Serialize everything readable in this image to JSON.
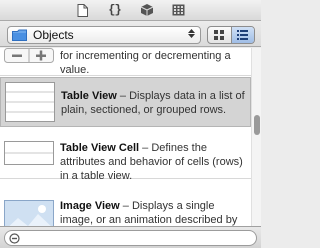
{
  "toolbar": {
    "tabs": [
      {
        "icon": "file-template-icon"
      },
      {
        "icon": "code-snippet-icon",
        "glyph": "{}"
      },
      {
        "icon": "object-cube-icon",
        "active": true
      },
      {
        "icon": "media-library-icon"
      }
    ]
  },
  "filter": {
    "selected": "Objects",
    "icon": "folder-icon",
    "view_mode": "list"
  },
  "items": [
    {
      "title": "",
      "separator": "",
      "description": "for incrementing or decrementing a value.",
      "thumb": "stepper",
      "selected": false
    },
    {
      "title": "Table View",
      "separator": " – ",
      "description": "Displays data in a list of plain, sectioned, or grouped rows.",
      "thumb": "table-view",
      "selected": true
    },
    {
      "title": "Table View Cell",
      "separator": " – ",
      "description": "Defines the attributes and behavior of cells (rows) in a table view.",
      "thumb": "table-view-cell",
      "selected": false
    },
    {
      "title": "Image View",
      "separator": " – ",
      "description": "Displays a single image, or an animation described by",
      "thumb": "image-view",
      "selected": false
    }
  ],
  "search": {
    "value": "",
    "placeholder": ""
  },
  "colors": {
    "selected_row": "#d4d4d4",
    "segment_active": "#9fbde6",
    "folder": "#4a90e2"
  }
}
